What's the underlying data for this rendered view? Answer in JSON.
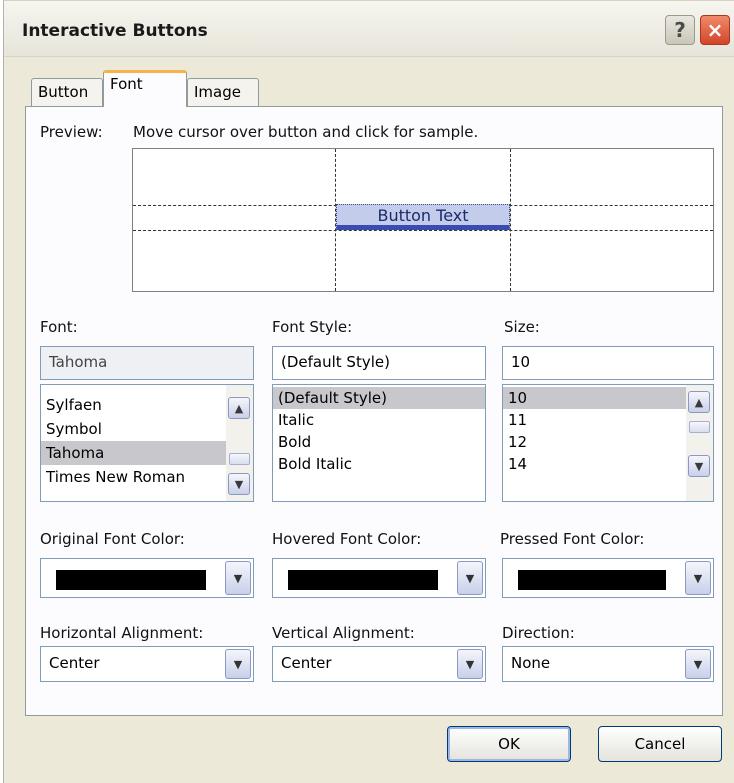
{
  "window": {
    "title": "Interactive Buttons",
    "help_icon": "?",
    "close_icon": "×"
  },
  "tabs": [
    {
      "label": "Button"
    },
    {
      "label": "Font"
    },
    {
      "label": "Image"
    }
  ],
  "preview": {
    "label": "Preview:",
    "hint": "Move cursor over button and click for sample.",
    "button_text": "Button Text"
  },
  "font": {
    "label": "Font:",
    "value": "Tahoma",
    "items": [
      "Sylfaen",
      "Symbol",
      "Tahoma",
      "Times New Roman"
    ],
    "selected": "Tahoma"
  },
  "font_style": {
    "label": "Font Style:",
    "value": "(Default Style)",
    "items": [
      "(Default Style)",
      "Italic",
      "Bold",
      "Bold Italic"
    ],
    "selected": "(Default Style)"
  },
  "size": {
    "label": "Size:",
    "value": "10",
    "items": [
      "10",
      "11",
      "12",
      "14"
    ],
    "selected": "10"
  },
  "colors": {
    "original_label": "Original Font Color:",
    "hovered_label": "Hovered Font Color:",
    "pressed_label": "Pressed Font Color:",
    "original_value": "#000000",
    "hovered_value": "#000000",
    "pressed_value": "#000000"
  },
  "alignment": {
    "horizontal_label": "Horizontal Alignment:",
    "horizontal_value": "Center",
    "vertical_label": "Vertical Alignment:",
    "vertical_value": "Center",
    "direction_label": "Direction:",
    "direction_value": "None"
  },
  "buttons": {
    "ok": "OK",
    "cancel": "Cancel"
  },
  "icons": {
    "scroll_up": "▲",
    "scroll_down": "▼",
    "dropdown": "▼"
  }
}
